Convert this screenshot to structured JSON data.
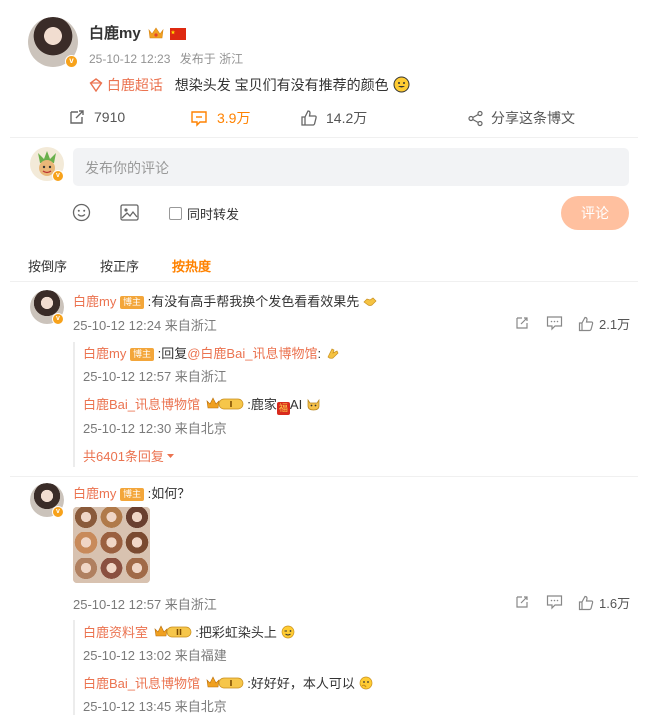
{
  "post": {
    "author": "白鹿my",
    "time": "25-10-12 12:23",
    "source": "发布于 浙江",
    "topic": "白鹿超话",
    "text": "想染头发 宝贝们有没有推荐的颜色",
    "actions": {
      "repost": "7910",
      "comments": "3.9万",
      "likes": "14.2万",
      "share": "分享这条博文"
    }
  },
  "composer": {
    "placeholder": "发布你的评论",
    "forward_label": "同时转发",
    "submit_label": "评论"
  },
  "sort": {
    "items": [
      "按倒序",
      "按正序",
      "按热度"
    ],
    "active": 2
  },
  "comments": [
    {
      "author": "白鹿my",
      "badge": "博主",
      "text": ":有没有高手帮我换个发色看看效果先",
      "meta": "25-10-12 12:24 来自浙江",
      "likes": "2.1万",
      "replies": [
        {
          "author": "白鹿my",
          "badge": "博主",
          "text_prefix": ":回复",
          "mention": "@白鹿Bai_讯息博物馆",
          "text": ":",
          "meta": "25-10-12 12:57 来自浙江"
        },
        {
          "author": "白鹿Bai_讯息博物馆",
          "level": "I",
          "text": ":鹿家",
          "text_tail": "AI",
          "meta": "25-10-12 12:30 来自北京"
        }
      ],
      "more": "共6401条回复"
    },
    {
      "author": "白鹿my",
      "badge": "博主",
      "text": ":如何？",
      "meta": "25-10-12 12:57 来自浙江",
      "likes": "1.6万",
      "replies": [
        {
          "author": "白鹿资料室",
          "level": "II",
          "text": ":把彩虹染头上",
          "meta": "25-10-12 13:02 来自福建"
        },
        {
          "author": "白鹿Bai_讯息博物馆",
          "level": "I",
          "text": ":好好好，本人可以",
          "meta": "25-10-12 13:45 来自北京"
        }
      ]
    }
  ],
  "colors": {
    "accent": "#ff8200",
    "name": "#eb7350",
    "submit_bg": "#ffc09f"
  }
}
